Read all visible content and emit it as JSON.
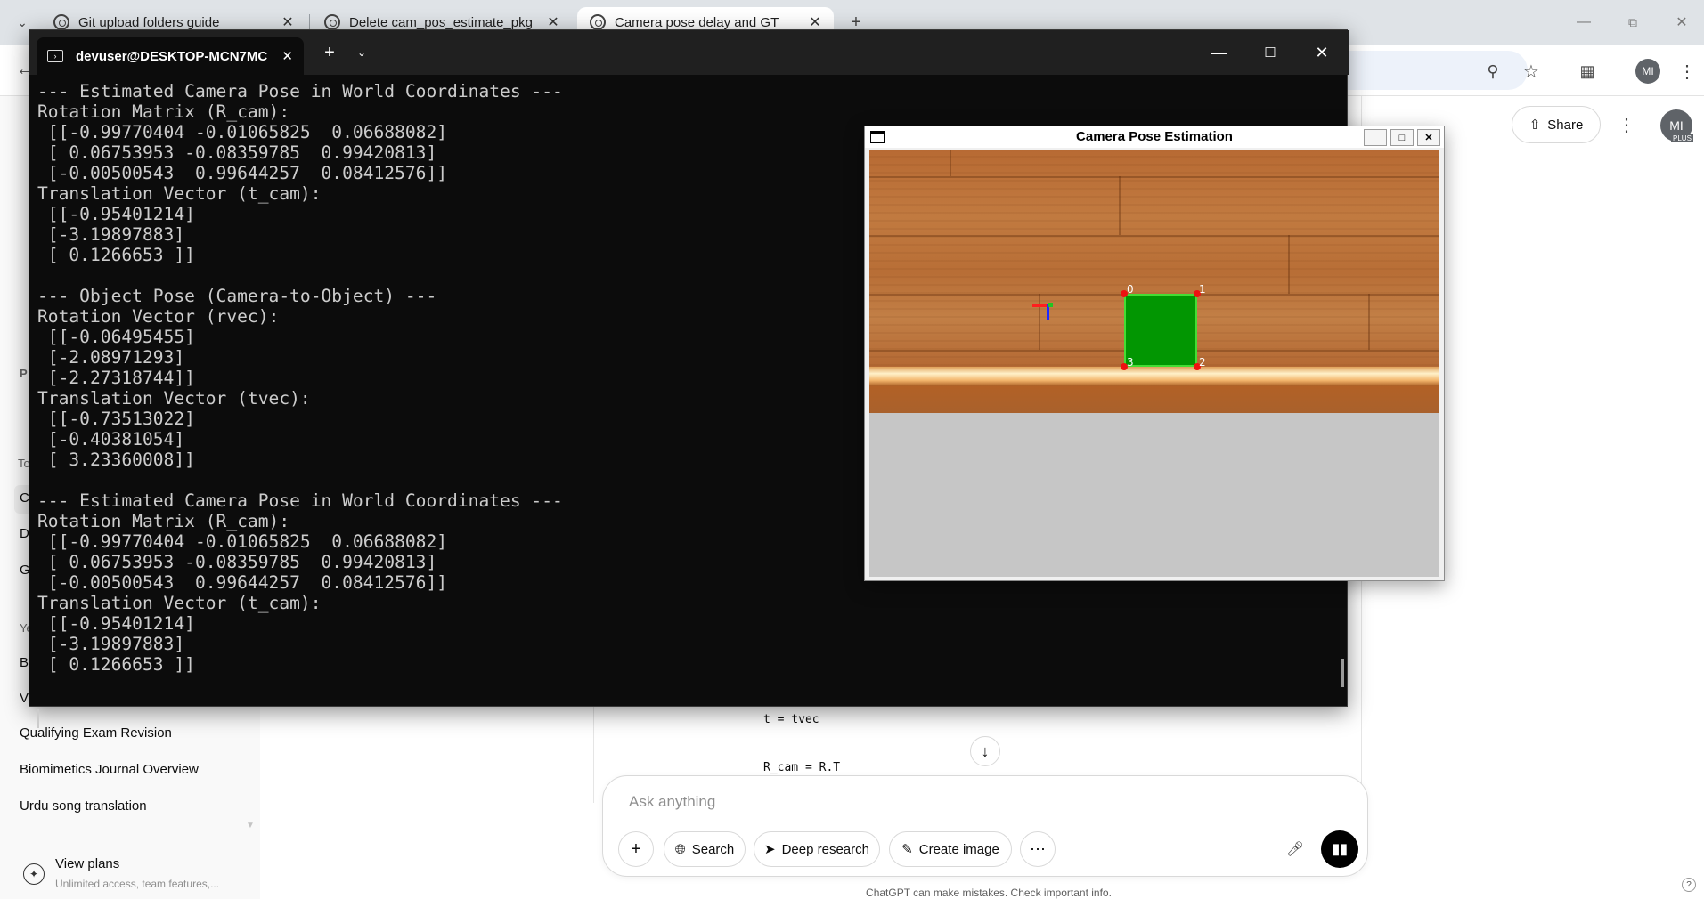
{
  "browser": {
    "tabs": [
      {
        "title": "Git upload folders guide"
      },
      {
        "title": "Delete cam_pos_estimate_pkg"
      },
      {
        "title": "Camera pose delay and GT"
      }
    ],
    "profile_initials": "MI"
  },
  "chatgpt": {
    "sidebar": {
      "items": [
        "Qualifying Exam Revision",
        "Biomimetics Journal Overview",
        "Urdu song translation"
      ],
      "cut_letters": [
        "P",
        "To",
        "C",
        "D",
        "G",
        "Ye",
        "B",
        "V"
      ],
      "view_plans": {
        "title": "View plans",
        "subtitle": "Unlimited access, team features,..."
      }
    },
    "header": {
      "share_label": "Share",
      "avatar_initials": "MI",
      "avatar_badge": "PLUS"
    },
    "code_lines": [
      "t = tvec",
      "R_cam = R.T"
    ],
    "composer": {
      "placeholder": "Ask anything",
      "buttons": {
        "search": "Search",
        "deep_research": "Deep research",
        "create_image": "Create image"
      }
    },
    "disclaimer": "ChatGPT can make mistakes. Check important info."
  },
  "terminal": {
    "tab_title": "devuser@DESKTOP-MCN7MC",
    "lines": [
      "--- Estimated Camera Pose in World Coordinates ---",
      "Rotation Matrix (R_cam):",
      " [[-0.99770404 -0.01065825  0.06688082]",
      " [ 0.06753953 -0.08359785  0.99420813]",
      " [-0.00500543  0.99644257  0.08412576]]",
      "Translation Vector (t_cam):",
      " [[-0.95401214]",
      " [-3.19897883]",
      " [ 0.1266653 ]]",
      "",
      "--- Object Pose (Camera-to-Object) ---",
      "Rotation Vector (rvec):",
      " [[-0.06495455]",
      " [-2.08971293]",
      " [-2.27318744]]",
      "Translation Vector (tvec):",
      " [[-0.73513022]",
      " [-0.40381054]",
      " [ 3.23360008]]",
      "",
      "--- Estimated Camera Pose in World Coordinates ---",
      "Rotation Matrix (R_cam):",
      " [[-0.99770404 -0.01065825  0.06688082]",
      " [ 0.06753953 -0.08359785  0.99420813]",
      " [-0.00500543  0.99644257  0.08412576]]",
      "Translation Vector (t_cam):",
      " [[-0.95401214]",
      " [-3.19897883]",
      " [ 0.1266653 ]]"
    ]
  },
  "opencv_window": {
    "title": "Camera Pose Estimation",
    "corner_labels": [
      "0",
      "1",
      "2",
      "3"
    ]
  },
  "colors": {
    "terminal_bg": "#0c0c0c",
    "terminal_text": "#cccccc",
    "marker_green": "#029602",
    "marker_outline": "#44dd33",
    "corner_red": "#ee1111"
  }
}
